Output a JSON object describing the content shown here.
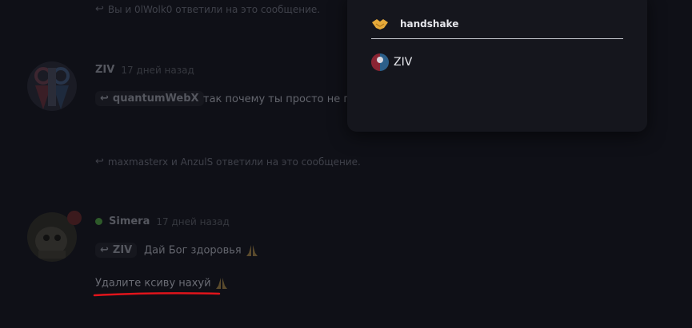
{
  "feed": {
    "notice_top": "Вы и 0lWolk0 ответили на это сообщение.",
    "msg1": {
      "author": "ZIV",
      "time": "17 дней назад",
      "reply_to": "quantumWebX",
      "text": "так почему ты просто не пр"
    },
    "notice_mid": "maxmasterx и AnzulS ответили на это сообщение.",
    "msg2": {
      "author": "Simera",
      "time": "17 дней назад",
      "reply_to": "ZIV",
      "text1": "Дай Бог здоровья",
      "text2": "Удалите ксиву нахуй"
    }
  },
  "popup": {
    "reaction_name": "handshake",
    "reaction_icon": "handshake-emoji",
    "users": [
      {
        "name": "ZIV"
      }
    ]
  },
  "colors": {
    "background": "#0f1017",
    "popup_bg": "#15161d",
    "annotation_red": "#e0141b",
    "online": "#2e5a2a"
  }
}
